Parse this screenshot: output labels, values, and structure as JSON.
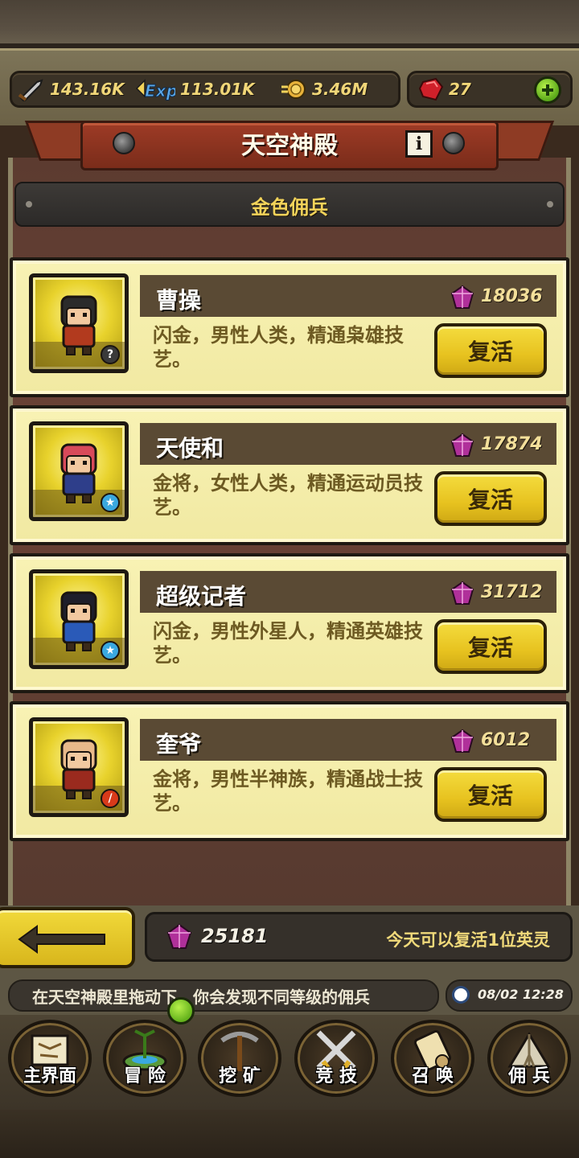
{
  "resources": {
    "attack": "143.16K",
    "exp": "113.01K",
    "gold": "3.46M",
    "rubies": "27"
  },
  "header": {
    "title": "天空神殿",
    "subtitle": "金色佣兵"
  },
  "heroes": [
    {
      "name": "曹操",
      "cost": "18036",
      "desc": "闪金，男性人类，精通枭雄技艺。",
      "button": "复活",
      "badge": "question",
      "hair": "#2b2b2b",
      "outfit": "#b23a1e"
    },
    {
      "name": "天使和",
      "cost": "17874",
      "desc": "金将，女性人类，精通运动员技艺。",
      "button": "复活",
      "badge": "star",
      "hair": "#d84a5a",
      "outfit": "#2e3e8a"
    },
    {
      "name": "超级记者",
      "cost": "31712",
      "desc": "闪金，男性外星人，精通英雄技艺。",
      "button": "复活",
      "badge": "star",
      "hair": "#1e1e2a",
      "outfit": "#2a5ab8"
    },
    {
      "name": "奎爷",
      "cost": "6012",
      "desc": "金将，男性半神族，精通战士技艺。",
      "button": "复活",
      "badge": "sword",
      "hair": "#e8b98a",
      "outfit": "#9a2a1e"
    }
  ],
  "status": {
    "gems": "25181",
    "note": "今天可以复活1位英灵"
  },
  "ticker": {
    "text": "在天空神殿里拖动下，你会发现不同等级的佣兵",
    "time": "08/02 12:28"
  },
  "nav": [
    {
      "label": "主界面",
      "icon": "map-scroll-icon"
    },
    {
      "label": "冒 险",
      "icon": "island-icon"
    },
    {
      "label": "挖 矿",
      "icon": "pickaxe-icon"
    },
    {
      "label": "竞 技",
      "icon": "crossed-swords-icon"
    },
    {
      "label": "召 唤",
      "icon": "summon-scroll-icon"
    },
    {
      "label": "佣 兵",
      "icon": "tent-icon"
    }
  ],
  "colors": {
    "gold_text": "#f2d35a",
    "card_bg": "#f8f2b4",
    "button_yellow": "#f4dc3e",
    "banner_red": "#9e3b26",
    "gem_purple": "#b0309a"
  }
}
